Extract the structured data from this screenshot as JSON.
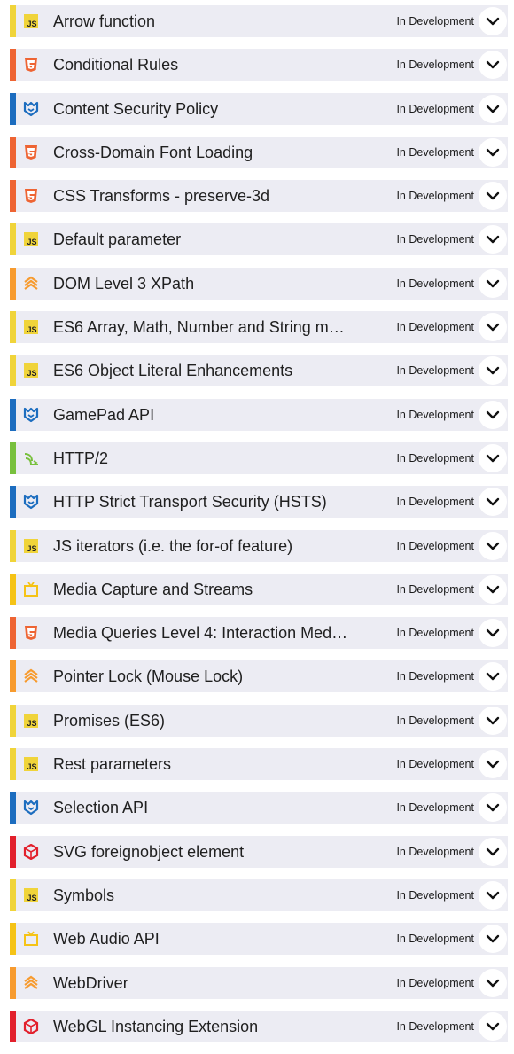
{
  "status_label": "In Development",
  "colors": {
    "js": "#f0d43a",
    "css": "#ee6433",
    "blue": "#1c6dbf",
    "orange": "#f79b2f",
    "green": "#78c03d",
    "yellow": "#f5c316",
    "red": "#e2202c",
    "row_bg": "#ececf3"
  },
  "features": [
    {
      "name": "Arrow function",
      "category": "js",
      "icon": "js-icon"
    },
    {
      "name": "Conditional Rules",
      "category": "css",
      "icon": "css3-icon"
    },
    {
      "name": "Content Security Policy",
      "category": "security",
      "icon": "security-icon"
    },
    {
      "name": "Cross-Domain Font Loading",
      "category": "css",
      "icon": "css3-icon"
    },
    {
      "name": "CSS Transforms - preserve-3d",
      "category": "css",
      "icon": "css3-icon"
    },
    {
      "name": "Default parameter",
      "category": "js",
      "icon": "js-icon"
    },
    {
      "name": "DOM Level 3 XPath",
      "category": "dom",
      "icon": "layers-icon"
    },
    {
      "name": "ES6 Array, Math, Number and String m…",
      "category": "js",
      "icon": "js-icon"
    },
    {
      "name": "ES6 Object Literal Enhancements",
      "category": "js",
      "icon": "js-icon"
    },
    {
      "name": "GamePad API",
      "category": "security",
      "icon": "security-icon"
    },
    {
      "name": "HTTP/2",
      "category": "network",
      "icon": "network-icon"
    },
    {
      "name": "HTTP Strict Transport Security (HSTS)",
      "category": "security",
      "icon": "security-icon"
    },
    {
      "name": "JS iterators (i.e. the for-of feature)",
      "category": "js",
      "icon": "js-icon"
    },
    {
      "name": "Media Capture and Streams",
      "category": "media",
      "icon": "media-icon"
    },
    {
      "name": "Media Queries Level 4: Interaction Med…",
      "category": "css",
      "icon": "css3-icon"
    },
    {
      "name": "Pointer Lock (Mouse Lock)",
      "category": "dom",
      "icon": "layers-icon"
    },
    {
      "name": "Promises (ES6)",
      "category": "js",
      "icon": "js-icon"
    },
    {
      "name": "Rest parameters",
      "category": "js",
      "icon": "js-icon"
    },
    {
      "name": "Selection API",
      "category": "security",
      "icon": "security-icon"
    },
    {
      "name": "SVG foreignobject element",
      "category": "graphics",
      "icon": "graphics-icon"
    },
    {
      "name": "Symbols",
      "category": "js",
      "icon": "js-icon"
    },
    {
      "name": "Web Audio API",
      "category": "media",
      "icon": "media-icon"
    },
    {
      "name": "WebDriver",
      "category": "dom",
      "icon": "layers-icon"
    },
    {
      "name": "WebGL Instancing Extension",
      "category": "graphics",
      "icon": "graphics-icon"
    }
  ]
}
